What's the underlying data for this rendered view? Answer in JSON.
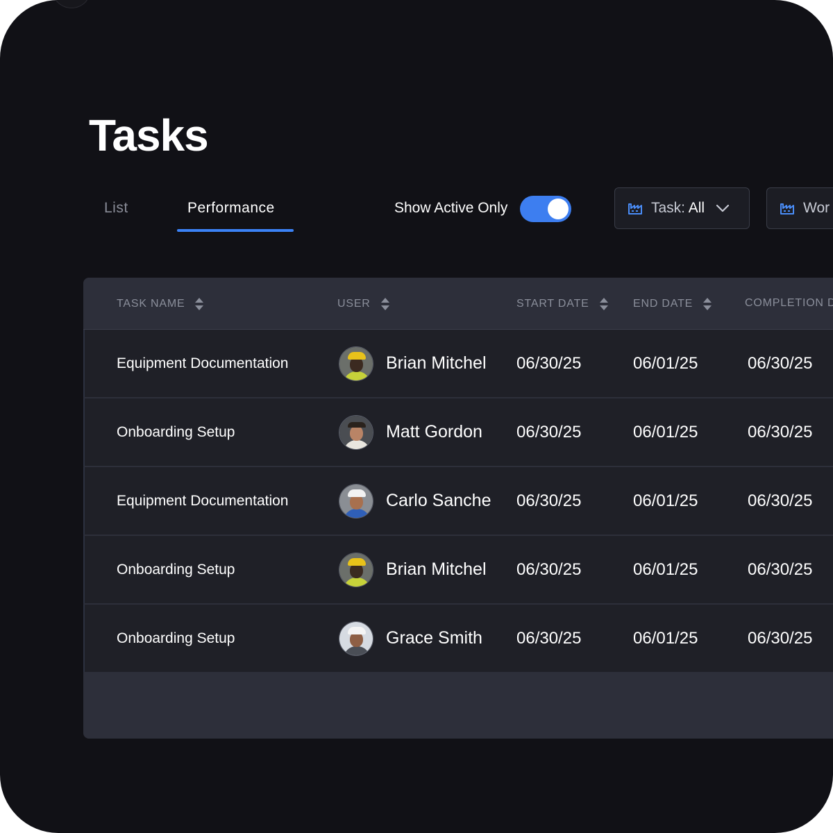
{
  "page": {
    "title": "Tasks"
  },
  "tabs": [
    {
      "label": "List",
      "active": false
    },
    {
      "label": "Performance",
      "active": true
    }
  ],
  "toggle": {
    "label": "Show Active Only",
    "on": true,
    "color": "#3d7ef0"
  },
  "filters": [
    {
      "prefix": "Task:",
      "value": "All",
      "icon": "factory-icon"
    },
    {
      "prefix": "Wor",
      "value": "",
      "icon": "factory-icon"
    }
  ],
  "table": {
    "columns": [
      "TASK NAME",
      "USER",
      "START DATE",
      "END DATE",
      "COMPLETION D"
    ],
    "rows": [
      {
        "task": "Equipment Documentation",
        "user": "Brian Mitchel",
        "start": "06/30/25",
        "end": "06/01/25",
        "completion": "06/30/25"
      },
      {
        "task": "Onboarding Setup",
        "user": "Matt Gordon",
        "start": "06/30/25",
        "end": "06/01/25",
        "completion": "06/30/25"
      },
      {
        "task": "Equipment Documentation",
        "user": "Carlo Sanche",
        "start": "06/30/25",
        "end": "06/01/25",
        "completion": "06/30/25"
      },
      {
        "task": "Onboarding Setup",
        "user": "Brian Mitchel",
        "start": "06/30/25",
        "end": "06/01/25",
        "completion": "06/30/25"
      },
      {
        "task": "Onboarding Setup",
        "user": "Grace Smith",
        "start": "06/30/25",
        "end": "06/01/25",
        "completion": "06/30/25"
      }
    ]
  },
  "colors": {
    "accent": "#3b82f6",
    "background": "#111116",
    "table_row": "#1f2027",
    "table_header": "#2d2f3a"
  }
}
